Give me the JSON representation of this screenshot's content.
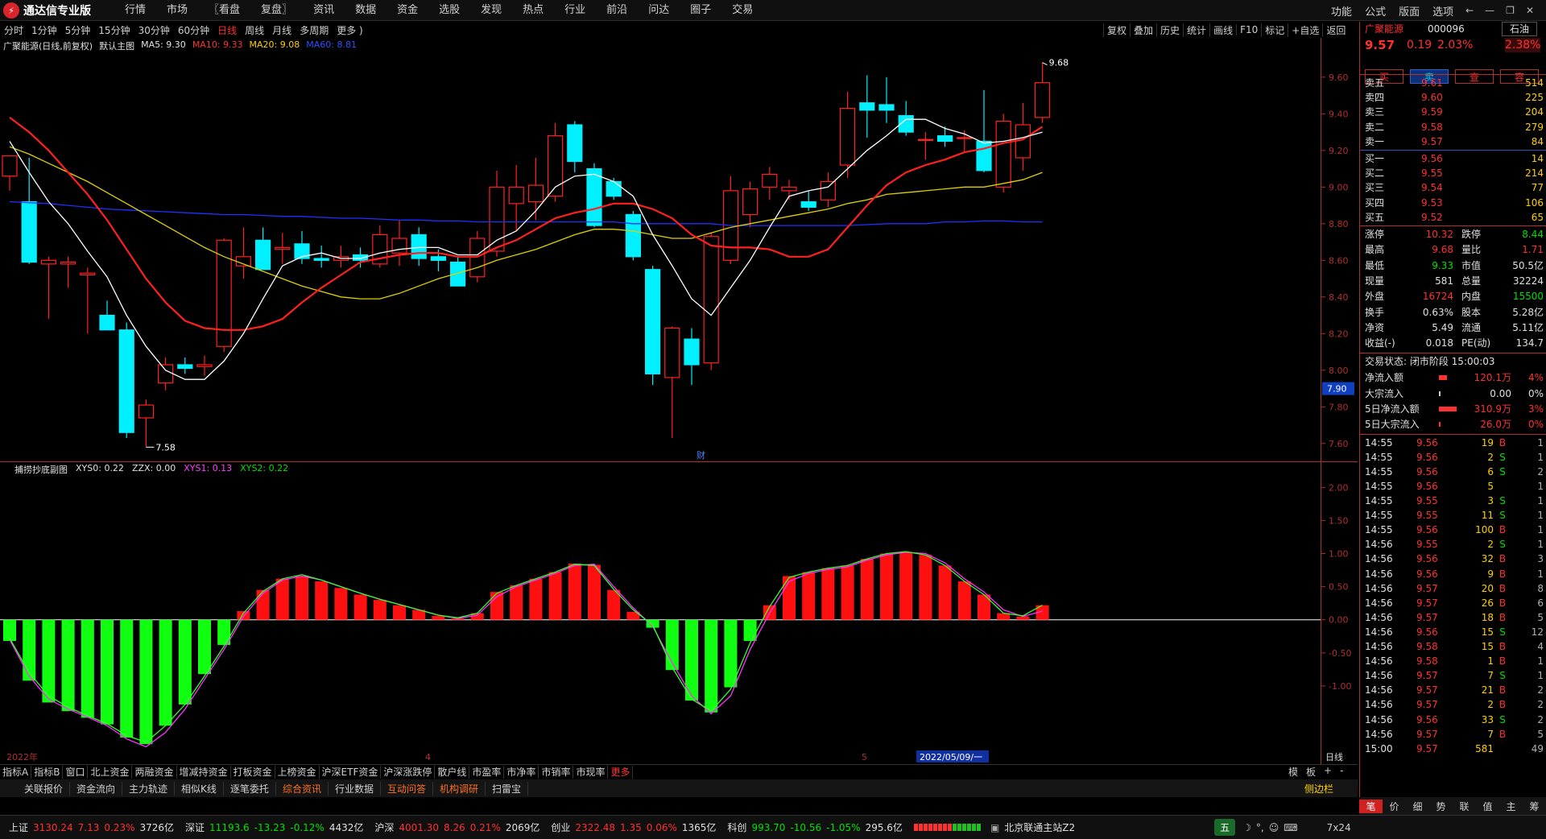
{
  "app": {
    "title": "通达信专业版"
  },
  "main_menu": [
    "行情",
    "市场",
    "〖看盘",
    "复盘〗",
    "资讯",
    "数据",
    "资金",
    "选股",
    "发现",
    "热点",
    "行业",
    "前沿",
    "问达",
    "圈子",
    "交易"
  ],
  "top_right": [
    "功能",
    "公式",
    "版面",
    "选项"
  ],
  "period_bar": [
    "分时",
    "1分钟",
    "5分钟",
    "15分钟",
    "30分钟",
    "60分钟",
    "日线",
    "周线",
    "月线",
    "多周期",
    "更多 )"
  ],
  "period_active": "日线",
  "chart_tools": [
    "复权",
    "叠加",
    "历史",
    "统计",
    "画线",
    "F10",
    "标记",
    "+自选",
    "返回"
  ],
  "main_legend": {
    "name": "广聚能源(日线,前复权)",
    "indicator": "默认主图",
    "ma5": "MA5: 9.30",
    "ma10": "MA10: 9.33",
    "ma20": "MA20: 9.08",
    "ma60": "MA60: 8.81"
  },
  "sub_legend": {
    "name": "捕捞抄底副图",
    "xys0": "XYS0: 0.22",
    "zzx": "ZZX: 0.00",
    "xys1": "XYS1: 0.13",
    "xys2": "XYS2: 0.22"
  },
  "price_axis": [
    "9.60",
    "9.40",
    "9.20",
    "9.00",
    "8.80",
    "8.60",
    "8.40",
    "8.20",
    "8.00",
    "7.80",
    "7.60"
  ],
  "price_axis_marker": "7.90",
  "sub_axis": [
    "2.00",
    "1.50",
    "1.00",
    "0.50",
    "0.00",
    "-0.50",
    "-1.00"
  ],
  "annotations": {
    "high": "9.68",
    "low": "7.58",
    "fin": "财"
  },
  "x_axis": {
    "left": "2022年",
    "m4": "4",
    "m5": "5",
    "cursor": "2022/05/09/一",
    "period": "日线"
  },
  "colors": {
    "up": "#ff2020",
    "down": "#00f0ff",
    "ma5": "#ffffff",
    "ma10": "#ff2020",
    "ma20": "#e0d000",
    "ma60": "#2030ff",
    "sub_up": "#ff1010",
    "sub_down": "#10ff10",
    "xys1": "#ff30ff",
    "xys2": "#30ff30"
  },
  "chart_data": {
    "type": "candlestick",
    "y_range": [
      7.52,
      9.74
    ],
    "candles": [
      {
        "o": 9.06,
        "h": 9.12,
        "l": 8.98,
        "c": 9.17
      },
      {
        "o": 8.92,
        "h": 9.16,
        "l": 8.58,
        "c": 8.59
      },
      {
        "o": 8.58,
        "h": 8.62,
        "l": 8.28,
        "c": 8.6
      },
      {
        "o": 8.58,
        "h": 8.62,
        "l": 8.45,
        "c": 8.59
      },
      {
        "o": 8.52,
        "h": 8.56,
        "l": 8.2,
        "c": 8.53
      },
      {
        "o": 8.3,
        "h": 8.38,
        "l": 8.26,
        "c": 8.22
      },
      {
        "o": 8.22,
        "h": 8.26,
        "l": 7.63,
        "c": 7.66
      },
      {
        "o": 7.74,
        "h": 7.84,
        "l": 7.58,
        "c": 7.81
      },
      {
        "o": 7.93,
        "h": 8.07,
        "l": 7.89,
        "c": 8.03
      },
      {
        "o": 8.03,
        "h": 8.07,
        "l": 7.98,
        "c": 8.01
      },
      {
        "o": 8.02,
        "h": 8.08,
        "l": 7.97,
        "c": 8.03
      },
      {
        "o": 8.13,
        "h": 8.72,
        "l": 8.1,
        "c": 8.71
      },
      {
        "o": 8.57,
        "h": 8.78,
        "l": 8.5,
        "c": 8.62
      },
      {
        "o": 8.71,
        "h": 8.78,
        "l": 8.58,
        "c": 8.55
      },
      {
        "o": 8.66,
        "h": 8.75,
        "l": 8.58,
        "c": 8.67
      },
      {
        "o": 8.69,
        "h": 8.76,
        "l": 8.58,
        "c": 8.61
      },
      {
        "o": 8.61,
        "h": 8.68,
        "l": 8.56,
        "c": 8.6
      },
      {
        "o": 8.6,
        "h": 8.68,
        "l": 8.56,
        "c": 8.62
      },
      {
        "o": 8.63,
        "h": 8.67,
        "l": 8.56,
        "c": 8.6
      },
      {
        "o": 8.58,
        "h": 8.79,
        "l": 8.56,
        "c": 8.74
      },
      {
        "o": 8.64,
        "h": 8.82,
        "l": 8.57,
        "c": 8.72
      },
      {
        "o": 8.74,
        "h": 8.78,
        "l": 8.57,
        "c": 8.61
      },
      {
        "o": 8.62,
        "h": 8.66,
        "l": 8.54,
        "c": 8.6
      },
      {
        "o": 8.59,
        "h": 8.62,
        "l": 8.51,
        "c": 8.46
      },
      {
        "o": 8.51,
        "h": 8.76,
        "l": 8.48,
        "c": 8.72
      },
      {
        "o": 8.65,
        "h": 9.09,
        "l": 8.62,
        "c": 9.0
      },
      {
        "o": 8.91,
        "h": 9.12,
        "l": 8.76,
        "c": 9.0
      },
      {
        "o": 8.92,
        "h": 9.16,
        "l": 8.82,
        "c": 9.01
      },
      {
        "o": 8.95,
        "h": 9.35,
        "l": 8.92,
        "c": 9.28
      },
      {
        "o": 9.34,
        "h": 9.36,
        "l": 9.08,
        "c": 9.14
      },
      {
        "o": 9.1,
        "h": 9.13,
        "l": 8.78,
        "c": 8.79
      },
      {
        "o": 9.03,
        "h": 9.05,
        "l": 8.93,
        "c": 8.95
      },
      {
        "o": 8.85,
        "h": 8.87,
        "l": 8.6,
        "c": 8.62
      },
      {
        "o": 8.55,
        "h": 8.57,
        "l": 7.92,
        "c": 7.98
      },
      {
        "o": 7.96,
        "h": 8.24,
        "l": 7.63,
        "c": 8.23
      },
      {
        "o": 8.17,
        "h": 8.23,
        "l": 7.92,
        "c": 8.03
      },
      {
        "o": 8.04,
        "h": 8.75,
        "l": 8.0,
        "c": 8.73
      },
      {
        "o": 8.6,
        "h": 9.06,
        "l": 8.58,
        "c": 8.98
      },
      {
        "o": 8.85,
        "h": 9.03,
        "l": 8.78,
        "c": 8.99
      },
      {
        "o": 9.0,
        "h": 9.11,
        "l": 8.93,
        "c": 9.07
      },
      {
        "o": 8.98,
        "h": 9.04,
        "l": 8.93,
        "c": 9.0
      },
      {
        "o": 8.92,
        "h": 8.98,
        "l": 8.87,
        "c": 8.89
      },
      {
        "o": 8.93,
        "h": 9.08,
        "l": 8.89,
        "c": 9.03
      },
      {
        "o": 9.12,
        "h": 9.52,
        "l": 9.05,
        "c": 9.43
      },
      {
        "o": 9.46,
        "h": 9.61,
        "l": 9.27,
        "c": 9.42
      },
      {
        "o": 9.45,
        "h": 9.6,
        "l": 9.35,
        "c": 9.42
      },
      {
        "o": 9.39,
        "h": 9.47,
        "l": 9.28,
        "c": 9.3
      },
      {
        "o": 9.26,
        "h": 9.3,
        "l": 9.15,
        "c": 9.26
      },
      {
        "o": 9.28,
        "h": 9.33,
        "l": 9.22,
        "c": 9.25
      },
      {
        "o": 9.27,
        "h": 9.31,
        "l": 9.19,
        "c": 9.27
      },
      {
        "o": 9.25,
        "h": 9.53,
        "l": 9.08,
        "c": 9.09
      },
      {
        "o": 9.0,
        "h": 9.4,
        "l": 8.97,
        "c": 9.36
      },
      {
        "o": 9.16,
        "h": 9.46,
        "l": 9.09,
        "c": 9.34
      },
      {
        "o": 9.38,
        "h": 9.68,
        "l": 9.35,
        "c": 9.57
      }
    ],
    "ma5": [
      9.25,
      9.08,
      8.92,
      8.8,
      8.65,
      8.51,
      8.3,
      8.13,
      8.0,
      7.95,
      7.95,
      8.05,
      8.2,
      8.39,
      8.57,
      8.62,
      8.64,
      8.61,
      8.61,
      8.64,
      8.66,
      8.67,
      8.67,
      8.63,
      8.63,
      8.71,
      8.76,
      8.87,
      9.0,
      9.06,
      9.07,
      9.03,
      8.95,
      8.74,
      8.57,
      8.39,
      8.3,
      8.45,
      8.6,
      8.78,
      8.95,
      8.98,
      9.0,
      9.1,
      9.2,
      9.28,
      9.37,
      9.37,
      9.32,
      9.29,
      9.24,
      9.25,
      9.27,
      9.3
    ],
    "ma10": [
      9.38,
      9.3,
      9.2,
      9.08,
      8.96,
      8.82,
      8.66,
      8.5,
      8.37,
      8.27,
      8.23,
      8.22,
      8.22,
      8.24,
      8.28,
      8.37,
      8.45,
      8.52,
      8.59,
      8.61,
      8.63,
      8.64,
      8.64,
      8.62,
      8.62,
      8.67,
      8.71,
      8.77,
      8.83,
      8.86,
      8.88,
      8.91,
      8.91,
      8.88,
      8.83,
      8.74,
      8.68,
      8.67,
      8.67,
      8.66,
      8.62,
      8.62,
      8.66,
      8.78,
      8.9,
      9.01,
      9.08,
      9.12,
      9.15,
      9.19,
      9.21,
      9.24,
      9.26,
      9.33
    ],
    "ma20": [
      9.22,
      9.18,
      9.13,
      9.08,
      9.03,
      8.97,
      8.91,
      8.85,
      8.79,
      8.73,
      8.67,
      8.62,
      8.58,
      8.54,
      8.5,
      8.46,
      8.43,
      8.4,
      8.39,
      8.39,
      8.42,
      8.46,
      8.5,
      8.53,
      8.56,
      8.6,
      8.63,
      8.66,
      8.7,
      8.74,
      8.77,
      8.77,
      8.76,
      8.74,
      8.72,
      8.72,
      8.75,
      8.78,
      8.8,
      8.82,
      8.84,
      8.86,
      8.88,
      8.91,
      8.93,
      8.96,
      8.97,
      8.98,
      8.99,
      9.0,
      9.0,
      9.02,
      9.04,
      9.08
    ],
    "ma60": [
      8.92,
      8.915,
      8.91,
      8.9,
      8.89,
      8.88,
      8.875,
      8.87,
      8.865,
      8.86,
      8.855,
      8.85,
      8.85,
      8.845,
      8.84,
      8.84,
      8.835,
      8.83,
      8.83,
      8.825,
      8.82,
      8.82,
      8.815,
      8.815,
      8.81,
      8.81,
      8.81,
      8.81,
      8.81,
      8.81,
      8.81,
      8.81,
      8.8,
      8.8,
      8.8,
      8.8,
      8.8,
      8.79,
      8.79,
      8.79,
      8.79,
      8.79,
      8.79,
      8.79,
      8.795,
      8.8,
      8.8,
      8.8,
      8.81,
      8.81,
      8.815,
      8.815,
      8.81,
      8.81
    ],
    "sub_values": [
      -0.32,
      -0.92,
      -1.25,
      -1.38,
      -1.48,
      -1.58,
      -1.78,
      -1.88,
      -1.6,
      -1.28,
      -0.82,
      -0.38,
      0.13,
      0.45,
      0.62,
      0.66,
      0.58,
      0.48,
      0.38,
      0.3,
      0.22,
      0.15,
      0.06,
      0.02,
      0.1,
      0.42,
      0.52,
      0.62,
      0.72,
      0.85,
      0.83,
      0.45,
      0.12,
      -0.12,
      -0.76,
      -1.22,
      -1.4,
      -1.02,
      -0.32,
      0.22,
      0.66,
      0.72,
      0.78,
      0.82,
      0.92,
      1.0,
      1.02,
      0.98,
      0.82,
      0.58,
      0.38,
      0.1,
      0.05,
      0.22
    ],
    "sub_range": [
      -1.95,
      2.15
    ],
    "xys1": [
      -0.3,
      -0.85,
      -1.2,
      -1.35,
      -1.47,
      -1.6,
      -1.8,
      -1.92,
      -1.7,
      -1.35,
      -0.9,
      -0.45,
      0.05,
      0.4,
      0.6,
      0.66,
      0.6,
      0.5,
      0.4,
      0.31,
      0.23,
      0.15,
      0.07,
      0.02,
      0.07,
      0.35,
      0.5,
      0.6,
      0.7,
      0.82,
      0.84,
      0.5,
      0.18,
      -0.1,
      -0.65,
      -1.15,
      -1.42,
      -1.15,
      -0.45,
      0.1,
      0.58,
      0.7,
      0.76,
      0.8,
      0.9,
      0.98,
      1.02,
      1.0,
      0.86,
      0.62,
      0.42,
      0.15,
      0.05,
      0.13
    ],
    "xys2": [
      -0.28,
      -0.8,
      -1.15,
      -1.32,
      -1.45,
      -1.57,
      -1.75,
      -1.85,
      -1.6,
      -1.28,
      -0.85,
      -0.4,
      0.1,
      0.43,
      0.62,
      0.68,
      0.6,
      0.5,
      0.4,
      0.31,
      0.23,
      0.15,
      0.07,
      0.03,
      0.1,
      0.4,
      0.52,
      0.62,
      0.72,
      0.84,
      0.82,
      0.46,
      0.15,
      -0.08,
      -0.72,
      -1.2,
      -1.38,
      -1.05,
      -0.35,
      0.2,
      0.64,
      0.72,
      0.78,
      0.82,
      0.92,
      1.0,
      1.03,
      0.98,
      0.82,
      0.58,
      0.38,
      0.1,
      0.06,
      0.22
    ]
  },
  "side": {
    "stock_name": "广聚能源",
    "stock_code": "000096",
    "industry": "石油",
    "price": "9.57",
    "change": "0.19",
    "change_pct": "2.03%",
    "amp": "2.38%",
    "buttons": [
      "买",
      "卖",
      "查",
      "容"
    ],
    "asks": [
      {
        "label": "卖五",
        "price": "9.61",
        "vol": "514"
      },
      {
        "label": "卖四",
        "price": "9.60",
        "vol": "225"
      },
      {
        "label": "卖三",
        "price": "9.59",
        "vol": "204"
      },
      {
        "label": "卖二",
        "price": "9.58",
        "vol": "279"
      },
      {
        "label": "卖一",
        "price": "9.57",
        "vol": "84"
      }
    ],
    "bids": [
      {
        "label": "买一",
        "price": "9.56",
        "vol": "14"
      },
      {
        "label": "买二",
        "price": "9.55",
        "vol": "214"
      },
      {
        "label": "买三",
        "price": "9.54",
        "vol": "77"
      },
      {
        "label": "买四",
        "price": "9.53",
        "vol": "106"
      },
      {
        "label": "买五",
        "price": "9.52",
        "vol": "65"
      }
    ],
    "stats": [
      {
        "l1": "涨停",
        "v1": "10.32",
        "c1": "r",
        "l2": "跌停",
        "v2": "8.44",
        "c2": "g"
      },
      {
        "l1": "最高",
        "v1": "9.68",
        "c1": "r",
        "l2": "量比",
        "v2": "1.71",
        "c2": "r"
      },
      {
        "l1": "最低",
        "v1": "9.33",
        "c1": "g",
        "l2": "市值",
        "v2": "50.5亿",
        "c2": "w"
      },
      {
        "l1": "现量",
        "v1": "581",
        "c1": "w",
        "l2": "总量",
        "v2": "32224",
        "c2": "w"
      },
      {
        "l1": "外盘",
        "v1": "16724",
        "c1": "r",
        "l2": "内盘",
        "v2": "15500",
        "c2": "g"
      },
      {
        "l1": "换手",
        "v1": "0.63%",
        "c1": "w",
        "l2": "股本",
        "v2": "5.28亿",
        "c2": "w"
      },
      {
        "l1": "净资",
        "v1": "5.49",
        "c1": "w",
        "l2": "流通",
        "v2": "5.11亿",
        "c2": "w"
      },
      {
        "l1": "收益(-)",
        "v1": "0.018",
        "c1": "w",
        "l2": "PE(动)",
        "v2": "134.7",
        "c2": "w"
      }
    ],
    "trade_status": "交易状态: 闭市阶段 15:00:03",
    "flows": [
      {
        "label": "净流入额",
        "value": "120.1万",
        "pct": "4%",
        "bar": 0.4,
        "c": "r"
      },
      {
        "label": "大宗流入",
        "value": "0.00",
        "pct": "0%",
        "bar": 0.02,
        "c": "w"
      },
      {
        "label": "5日净流入额",
        "value": "310.9万",
        "pct": "3%",
        "bar": 0.9,
        "c": "r"
      },
      {
        "label": "5日大宗流入",
        "value": "26.0万",
        "pct": "0%",
        "bar": 0.05,
        "c": "r"
      }
    ],
    "ticks": [
      {
        "t": "14:55",
        "p": "9.56",
        "v": "19",
        "s": "B",
        "n": "1"
      },
      {
        "t": "14:55",
        "p": "9.56",
        "v": "2",
        "s": "S",
        "n": "1"
      },
      {
        "t": "14:55",
        "p": "9.56",
        "v": "6",
        "s": "S",
        "n": "2"
      },
      {
        "t": "14:55",
        "p": "9.56",
        "v": "5",
        "s": "",
        "n": "1"
      },
      {
        "t": "14:55",
        "p": "9.55",
        "v": "3",
        "s": "S",
        "n": "1"
      },
      {
        "t": "14:55",
        "p": "9.55",
        "v": "11",
        "s": "S",
        "n": "1"
      },
      {
        "t": "14:55",
        "p": "9.56",
        "v": "100",
        "s": "B",
        "n": "1"
      },
      {
        "t": "14:56",
        "p": "9.55",
        "v": "2",
        "s": "S",
        "n": "1"
      },
      {
        "t": "14:56",
        "p": "9.56",
        "v": "32",
        "s": "B",
        "n": "3"
      },
      {
        "t": "14:56",
        "p": "9.56",
        "v": "9",
        "s": "B",
        "n": "1"
      },
      {
        "t": "14:56",
        "p": "9.57",
        "v": "20",
        "s": "B",
        "n": "8"
      },
      {
        "t": "14:56",
        "p": "9.57",
        "v": "26",
        "s": "B",
        "n": "6"
      },
      {
        "t": "14:56",
        "p": "9.57",
        "v": "18",
        "s": "B",
        "n": "5"
      },
      {
        "t": "14:56",
        "p": "9.56",
        "v": "15",
        "s": "S",
        "n": "12"
      },
      {
        "t": "14:56",
        "p": "9.58",
        "v": "15",
        "s": "B",
        "n": "4"
      },
      {
        "t": "14:56",
        "p": "9.58",
        "v": "1",
        "s": "B",
        "n": "1"
      },
      {
        "t": "14:56",
        "p": "9.57",
        "v": "7",
        "s": "S",
        "n": "1"
      },
      {
        "t": "14:56",
        "p": "9.57",
        "v": "21",
        "s": "B",
        "n": "2"
      },
      {
        "t": "14:56",
        "p": "9.57",
        "v": "2",
        "s": "B",
        "n": "2"
      },
      {
        "t": "14:56",
        "p": "9.56",
        "v": "33",
        "s": "S",
        "n": "2"
      },
      {
        "t": "14:56",
        "p": "9.57",
        "v": "7",
        "s": "B",
        "n": "5"
      },
      {
        "t": "15:00",
        "p": "9.57",
        "v": "581",
        "s": "",
        "n": "49"
      }
    ],
    "bottom_tabs": [
      "笔",
      "价",
      "细",
      "势",
      "联",
      "值",
      "主",
      "筹"
    ]
  },
  "ticker_tabs": [
    "指标A",
    "指标B",
    "窗口",
    "北上资金",
    "两融资金",
    "增减持资金",
    "打板资金",
    "上榜资金",
    "沪深ETF资金",
    "沪深涨跌停",
    "散户线",
    "市盈率",
    "市净率",
    "市销率",
    "市现率",
    "更多"
  ],
  "ticker_right": [
    "模",
    "板",
    "+",
    "-"
  ],
  "info_tabs": [
    "关联报价",
    "资金流向",
    "主力轨迹",
    "相似K线",
    "逐笔委托",
    "综合资讯",
    "行业数据",
    "互动问答",
    "机构调研",
    "扫雷宝"
  ],
  "info_tabs_highlight": [
    "综合资讯",
    "互动问答",
    "机构调研"
  ],
  "side_toggle": "侧边栏",
  "status": {
    "sh": {
      "name": "上证",
      "price": "3130.24",
      "chg": "7.13",
      "pct": "0.23%",
      "amt": "3726亿"
    },
    "sz": {
      "name": "深证",
      "price": "11193.6",
      "chg": "-13.23",
      "pct": "-0.12%",
      "amt": "4432亿"
    },
    "hs": {
      "name": "沪深",
      "price": "4001.30",
      "chg": "8.26",
      "pct": "0.21%",
      "amt": "2069亿"
    },
    "cy": {
      "name": "创业",
      "price": "2322.48",
      "chg": "1.35",
      "pct": "0.06%",
      "amt": "1365亿"
    },
    "kc": {
      "name": "科创",
      "price": "993.70",
      "chg": "-10.56",
      "pct": "-1.05%",
      "amt": "295.6亿"
    },
    "server": "北京联通主站Z2",
    "ime": "五",
    "time_mode": "7x24"
  }
}
